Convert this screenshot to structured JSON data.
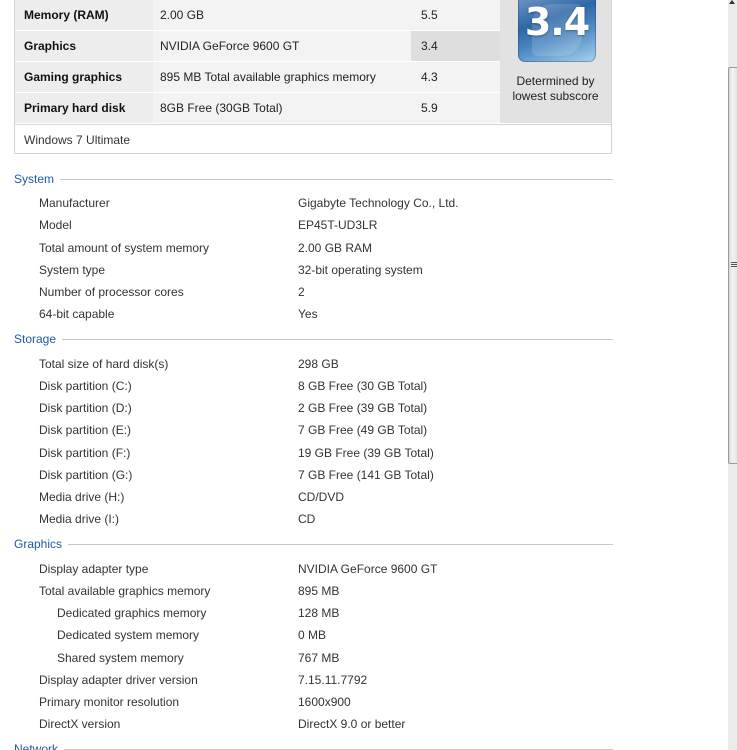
{
  "score_table": {
    "rows": [
      {
        "component": "Memory (RAM)",
        "details": "2.00 GB",
        "subscore": "5.5",
        "lowest": false
      },
      {
        "component": "Graphics",
        "details": "NVIDIA GeForce 9600 GT",
        "subscore": "3.4",
        "lowest": true
      },
      {
        "component": "Gaming graphics",
        "details": "895 MB Total available graphics memory",
        "subscore": "4.3",
        "lowest": false
      },
      {
        "component": "Primary hard disk",
        "details": "8GB Free (30GB Total)",
        "subscore": "5.9",
        "lowest": false
      }
    ],
    "base_score": "3.4",
    "base_score_caption": "Determined by lowest subscore",
    "edition": "Windows 7 Ultimate"
  },
  "sections": {
    "system": {
      "title": "System",
      "rows": [
        {
          "label": "Manufacturer",
          "value": "Gigabyte Technology Co., Ltd."
        },
        {
          "label": "Model",
          "value": "EP45T-UD3LR"
        },
        {
          "label": "Total amount of system memory",
          "value": "2.00 GB RAM"
        },
        {
          "label": "System type",
          "value": "32-bit operating system"
        },
        {
          "label": "Number of processor cores",
          "value": "2"
        },
        {
          "label": "64-bit capable",
          "value": "Yes"
        }
      ]
    },
    "storage": {
      "title": "Storage",
      "rows": [
        {
          "label": "Total size of hard disk(s)",
          "value": "298 GB"
        },
        {
          "label": "Disk partition (C:)",
          "value": "8 GB Free (30 GB Total)"
        },
        {
          "label": "Disk partition (D:)",
          "value": "2 GB Free (39 GB Total)"
        },
        {
          "label": "Disk partition (E:)",
          "value": "7 GB Free (49 GB Total)"
        },
        {
          "label": "Disk partition (F:)",
          "value": "19 GB Free (39 GB Total)"
        },
        {
          "label": "Disk partition (G:)",
          "value": "7 GB Free (141 GB Total)"
        },
        {
          "label": "Media drive (H:)",
          "value": "CD/DVD"
        },
        {
          "label": "Media drive (I:)",
          "value": "CD"
        }
      ]
    },
    "graphics": {
      "title": "Graphics",
      "rows": [
        {
          "label": "Display adapter type",
          "value": "NVIDIA GeForce 9600 GT"
        },
        {
          "label": "Total available graphics memory",
          "value": "895 MB"
        },
        {
          "label": "Dedicated graphics memory",
          "value": "128 MB",
          "indent": true
        },
        {
          "label": "Dedicated system memory",
          "value": "0 MB",
          "indent": true
        },
        {
          "label": "Shared system memory",
          "value": "767 MB",
          "indent": true
        },
        {
          "label": "Display adapter driver version",
          "value": "7.15.11.7792"
        },
        {
          "label": "Primary monitor resolution",
          "value": "1600x900"
        },
        {
          "label": "DirectX version",
          "value": "DirectX 9.0 or better"
        }
      ]
    },
    "network": {
      "title": "Network"
    }
  },
  "colors": {
    "section_title": "#1e5aa8",
    "lowest_subscore_bg": "#dedede",
    "badge_blue": "#2e67a6"
  }
}
